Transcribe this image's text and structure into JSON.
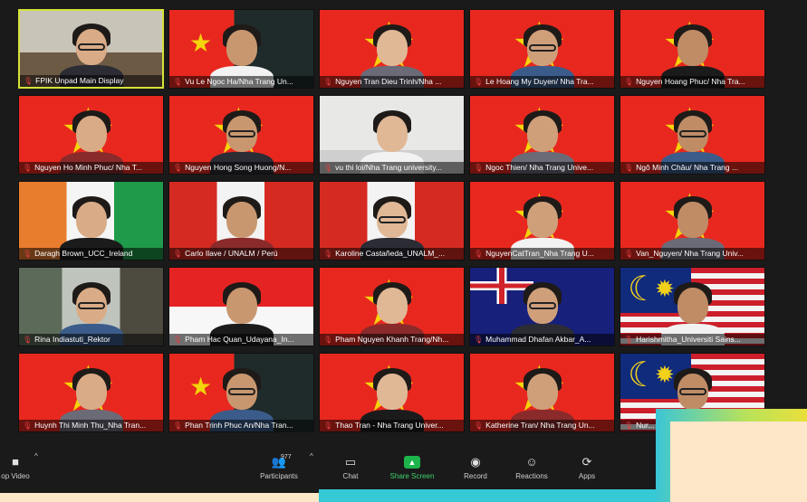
{
  "colors": {
    "vietnam_red": "#e8281f",
    "vietnam_star": "#f4d40a",
    "share_green": "#1db44b",
    "active_speaker": "#d6e23a",
    "overlay_cream": "#fde7c8",
    "overlay_cyan": "#35c9d6"
  },
  "participants": [
    {
      "name": "FPIK Unpad Main Display",
      "bg": "room"
    },
    {
      "name": "Vu Le Ngoc Ha/Nha Trang Un...",
      "bg": "vietnam-small"
    },
    {
      "name": "Nguyen Tran Dieu Trinh/Nha ...",
      "bg": "vietnam"
    },
    {
      "name": "Le Hoang My Duyen/ Nha Tra...",
      "bg": "vietnam"
    },
    {
      "name": "Nguyen Hoang Phuc/ Nha Tra...",
      "bg": "vietnam"
    },
    {
      "name": "Nguyen Ho Minh Phuc/ Nha T...",
      "bg": "vietnam"
    },
    {
      "name": "Nguyen Hong Song Huong/N...",
      "bg": "vietnam"
    },
    {
      "name": "vu thi loi/Nha Trang university...",
      "bg": "room-white"
    },
    {
      "name": "Ngoc Thien/ Nha Trang Unive...",
      "bg": "vietnam"
    },
    {
      "name": "Ngô Minh Châu/ Nha Trang ...",
      "bg": "vietnam"
    },
    {
      "name": "Daragh Brown_UCC_Ireland",
      "bg": "ireland"
    },
    {
      "name": "Carlo Ilave  / UNALM / Perú",
      "bg": "peru"
    },
    {
      "name": "Karoline Castañeda_UNALM_...",
      "bg": "peru"
    },
    {
      "name": "NguyenCatTran_Nha Trang U...",
      "bg": "vietnam"
    },
    {
      "name": "Van_Nguyen/ Nha Trang Univ...",
      "bg": "vietnam"
    },
    {
      "name": "Rina Indiastuti_Rektor",
      "bg": "room-office"
    },
    {
      "name": "Pham Hac Quan_Udayana_In...",
      "bg": "indonesia"
    },
    {
      "name": "Pham Nguyen Khanh Trang/Nh...",
      "bg": "vietnam"
    },
    {
      "name": "Muhammad Dhafan Akbar_A...",
      "bg": "newzealand"
    },
    {
      "name": "Harishmitha_Universiti Sains...",
      "bg": "malaysia"
    },
    {
      "name": "Huynh Thi Minh Thu_Nha Tran...",
      "bg": "vietnam"
    },
    {
      "name": "Phan Trinh Phuc An/Nha Tran...",
      "bg": "vietnam-small"
    },
    {
      "name": "Thao Tran - Nha Trang Univer...",
      "bg": "vietnam"
    },
    {
      "name": "Katherine Tran/ Nha Trang Un...",
      "bg": "vietnam"
    },
    {
      "name": "Nur...",
      "bg": "malaysia"
    }
  ],
  "toolbar": {
    "video_label": "op Video",
    "participants_label": "Participants",
    "participants_count": "977",
    "chat_label": "Chat",
    "share_label": "Share Screen",
    "record_label": "Record",
    "reactions_label": "Reactions",
    "apps_label": "Apps"
  },
  "icons": {
    "video": "video-camera-icon",
    "participants": "people-icon",
    "chat": "speech-bubble-icon",
    "share": "share-arrow-icon",
    "record": "record-dot-icon",
    "reactions": "smiley-plus-icon",
    "apps": "apps-icon",
    "muted": "muted-mic-icon"
  }
}
